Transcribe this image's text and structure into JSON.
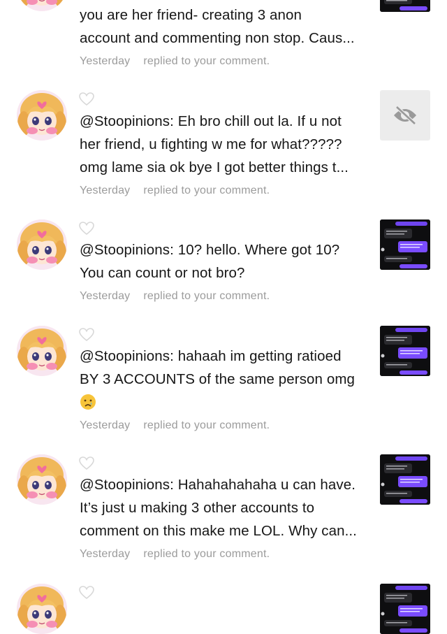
{
  "notifications": [
    {
      "lines": [
        "you are her friend- creating 3 anon",
        "account and commenting non stop. Caus..."
      ],
      "time": "Yesterday",
      "action": "replied to your comment.",
      "thumbnail": "chat-screenshot"
    },
    {
      "lines": [
        "@Stoopinions: Eh bro chill out la. If u not",
        "her friend, u fighting w me for what?????",
        "omg lame sia ok bye I got better things t..."
      ],
      "time": "Yesterday",
      "action": "replied to your comment.",
      "thumbnail": "hidden-eye-icon"
    },
    {
      "lines": [
        "@Stoopinions: 10? hello. Where got 10?",
        "You can count or not bro?"
      ],
      "time": "Yesterday",
      "action": "replied to your comment.",
      "thumbnail": "chat-screenshot"
    },
    {
      "lines": [
        "@Stoopinions: hahaah im getting ratioed",
        "BY 3 ACCOUNTS of the same person omg"
      ],
      "emoji": "crying-face-emoji",
      "time": "Yesterday",
      "action": "replied to your comment.",
      "thumbnail": "chat-screenshot"
    },
    {
      "lines": [
        "@Stoopinions: Hahahahahaha u can have.",
        "It’s just u making 3 other accounts to",
        "comment on this make me LOL. Why can..."
      ],
      "time": "Yesterday",
      "action": "replied to your comment.",
      "thumbnail": "chat-screenshot"
    }
  ],
  "colors": {
    "text": "#161616",
    "meta": "#9b9b9b",
    "chat_purple": "#7b4dff",
    "thumb_bg": "#101010"
  }
}
